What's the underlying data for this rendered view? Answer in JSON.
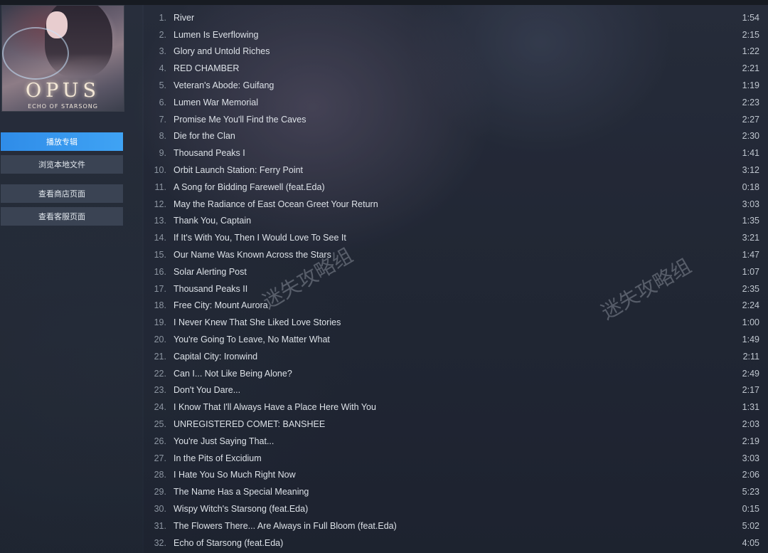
{
  "album": {
    "cover_title": "OPUS",
    "cover_subtitle": "ECHO OF STARSONG"
  },
  "sidebar": {
    "buttons": [
      {
        "label": "播放专辑",
        "active": true
      },
      {
        "label": "浏览本地文件",
        "active": false
      },
      {
        "label": "查看商店页面",
        "active": false
      },
      {
        "label": "查看客服页面",
        "active": false
      }
    ]
  },
  "watermarks": [
    "迷失攻略组",
    "迷失攻略组"
  ],
  "tracks": [
    {
      "num": "1.",
      "title": "River",
      "duration": "1:54"
    },
    {
      "num": "2.",
      "title": "Lumen Is Everflowing",
      "duration": "2:15"
    },
    {
      "num": "3.",
      "title": "Glory and Untold Riches",
      "duration": "1:22"
    },
    {
      "num": "4.",
      "title": "RED CHAMBER",
      "duration": "2:21"
    },
    {
      "num": "5.",
      "title": "Veteran's Abode: Guifang",
      "duration": "1:19"
    },
    {
      "num": "6.",
      "title": "Lumen War Memorial",
      "duration": "2:23"
    },
    {
      "num": "7.",
      "title": "Promise Me You'll Find the Caves",
      "duration": "2:27"
    },
    {
      "num": "8.",
      "title": "Die for the Clan",
      "duration": "2:30"
    },
    {
      "num": "9.",
      "title": "Thousand Peaks I",
      "duration": "1:41"
    },
    {
      "num": "10.",
      "title": "Orbit Launch Station: Ferry Point",
      "duration": "3:12"
    },
    {
      "num": "11.",
      "title": "A Song for Bidding Farewell (feat.Eda)",
      "duration": "0:18"
    },
    {
      "num": "12.",
      "title": "May the Radiance of East Ocean Greet Your Return",
      "duration": "3:03"
    },
    {
      "num": "13.",
      "title": "Thank You, Captain",
      "duration": "1:35"
    },
    {
      "num": "14.",
      "title": "If It's With You, Then I Would Love To See It",
      "duration": "3:21"
    },
    {
      "num": "15.",
      "title": "Our Name Was Known Across the Stars",
      "duration": "1:47"
    },
    {
      "num": "16.",
      "title": "Solar Alerting Post",
      "duration": "1:07"
    },
    {
      "num": "17.",
      "title": "Thousand Peaks II",
      "duration": "2:35"
    },
    {
      "num": "18.",
      "title": "Free City: Mount Aurora",
      "duration": "2:24"
    },
    {
      "num": "19.",
      "title": "I Never Knew That She Liked Love Stories",
      "duration": "1:00"
    },
    {
      "num": "20.",
      "title": "You're Going To Leave, No Matter What",
      "duration": "1:49"
    },
    {
      "num": "21.",
      "title": "Capital City: Ironwind",
      "duration": "2:11"
    },
    {
      "num": "22.",
      "title": "Can I... Not Like Being Alone?",
      "duration": "2:49"
    },
    {
      "num": "23.",
      "title": "Don't You Dare...",
      "duration": "2:17"
    },
    {
      "num": "24.",
      "title": "I Know That I'll Always Have a Place Here With You",
      "duration": "1:31"
    },
    {
      "num": "25.",
      "title": "UNREGISTERED COMET: BANSHEE",
      "duration": "2:03"
    },
    {
      "num": "26.",
      "title": "You're Just Saying That...",
      "duration": "2:19"
    },
    {
      "num": "27.",
      "title": "In the Pits of Excidium",
      "duration": "3:03"
    },
    {
      "num": "28.",
      "title": "I Hate You So Much Right Now",
      "duration": "2:06"
    },
    {
      "num": "29.",
      "title": "The Name Has a Special Meaning",
      "duration": "5:23"
    },
    {
      "num": "30.",
      "title": "Wispy Witch's Starsong (feat.Eda)",
      "duration": "0:15"
    },
    {
      "num": "31.",
      "title": "The Flowers There... Are Always in Full Bloom (feat.Eda)",
      "duration": "5:02"
    },
    {
      "num": "32.",
      "title": "Echo of Starsong (feat.Eda)",
      "duration": "4:05"
    }
  ]
}
